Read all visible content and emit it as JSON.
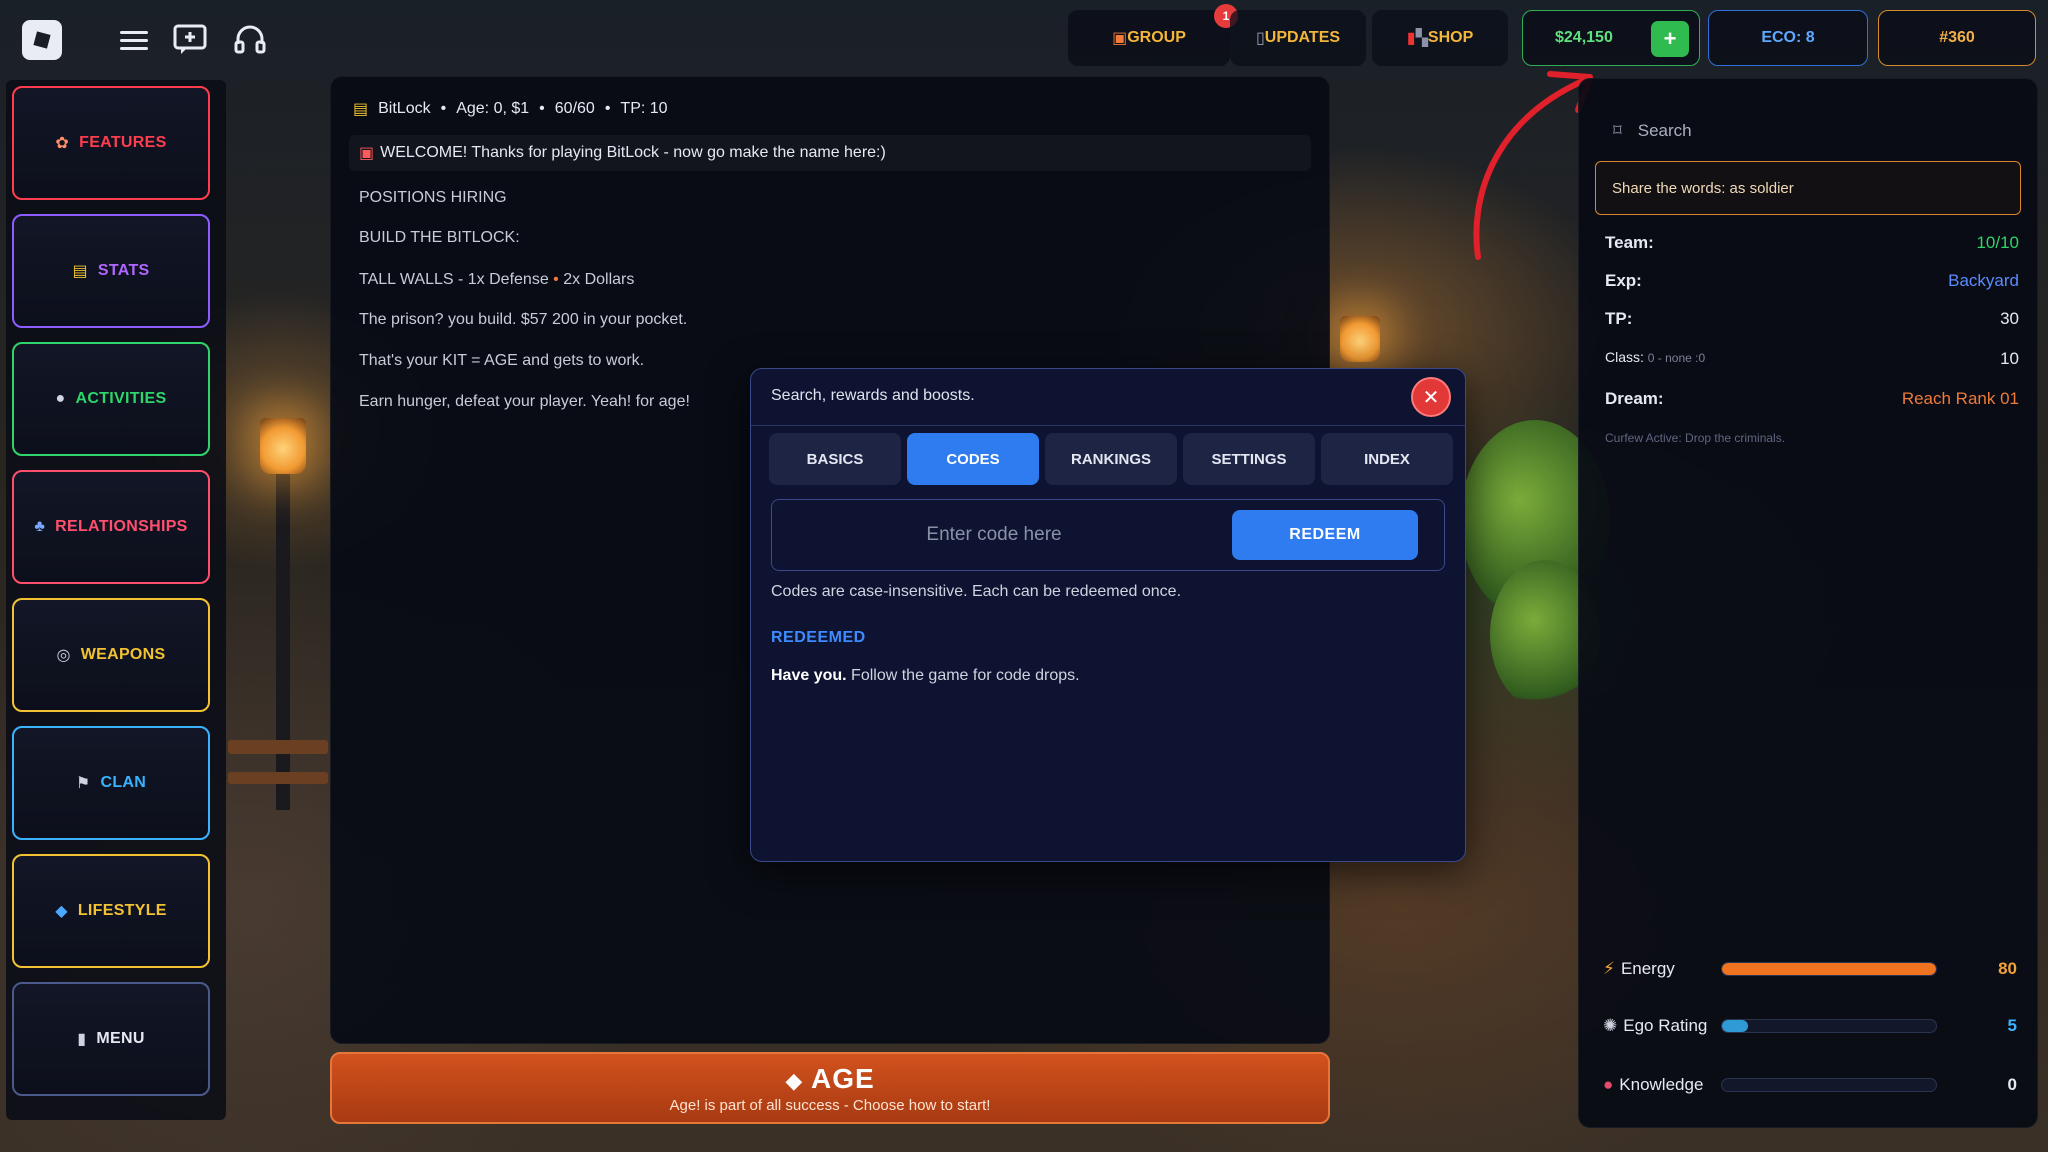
{
  "topbar": {
    "group_label": "GROUP",
    "group_badge": "1",
    "updates_label": "UPDATES",
    "shop_label": "SHOP",
    "money": "$24,150",
    "add_symbol": "+",
    "eco": "ECO: 8",
    "rank": "#360",
    "icons": [
      "roblox-logo",
      "hamburger-menu-icon",
      "chat-icon",
      "headset-icon",
      "gift-icon",
      "phone-icon",
      "ticket-icon"
    ]
  },
  "sidebar": {
    "items": [
      {
        "label": "FEATURES",
        "icon": "✿",
        "color": "#ff3d4e"
      },
      {
        "label": "STATS",
        "icon": "▤",
        "color": "#b067ff"
      },
      {
        "label": "ACTIVITIES",
        "icon": "●",
        "color": "#2fd46a"
      },
      {
        "label": "RELATIONSHIPS",
        "icon": "♣",
        "color": "#ff4f6d"
      },
      {
        "label": "WEAPONS",
        "icon": "◎",
        "color": "#f2c233"
      },
      {
        "label": "CLAN",
        "icon": "⚑",
        "color": "#3ab3ff"
      },
      {
        "label": "LIFESTYLE",
        "icon": "◆",
        "color": "#f2c233"
      },
      {
        "label": "MENU",
        "icon": "▮",
        "color": "#e6e9f2"
      }
    ]
  },
  "main": {
    "header": {
      "name": "BitLock",
      "age": "Age: 0, $1",
      "health": "60/60",
      "tp": "TP: 10"
    },
    "welcome": "WELCOME! Thanks for playing BitLock - now go make the name here:)",
    "lines": [
      "POSITIONS HIRING",
      "BUILD THE BITLOCK:",
      "TALL WALLS - 1x Defense",
      "2x Dollars",
      "The prison? you build. $57 200 in your pocket.",
      "That's your KIT = AGE and gets to work.",
      "Earn hunger, defeat your player. Yeah! for age!"
    ]
  },
  "age_button": {
    "title": "AGE",
    "subtitle": "Age! is part of all success - Choose how to start!"
  },
  "right_panel": {
    "search_label": "Search",
    "share_text": "Share the words: as soldier",
    "team_label": "Team:",
    "team_value": "10/10",
    "exp_label": "Exp:",
    "exp_value": "Backyard",
    "tp_label": "TP:",
    "tp_value": "30",
    "class_label": "Class:",
    "class_detail": "0 - none :0",
    "class_value": "10",
    "dream_label": "Dream:",
    "dream_value": "Reach Rank 01",
    "curfew_note": "Curfew Active: Drop the criminals.",
    "meters": [
      {
        "label": "Energy",
        "value": "80",
        "fill": 1.0,
        "color": "#f0741f",
        "value_color": "#f2a23a"
      },
      {
        "label": "Ego Rating",
        "value": "5",
        "fill": 0.12,
        "color": "#2f9bd6",
        "value_color": "#3db3ff"
      },
      {
        "label": "Knowledge",
        "value": "0",
        "fill": 0.0,
        "color": "#e54b6d",
        "value_color": "#e6e9f2"
      }
    ]
  },
  "modal": {
    "title": "Search, rewards and boosts.",
    "close_symbol": "✕",
    "tabs": [
      "BASICS",
      "CODES",
      "RANKINGS",
      "SETTINGS",
      "INDEX"
    ],
    "active_tab": "CODES",
    "code_placeholder": "Enter code here",
    "code_value": "",
    "redeem_label": "REDEEM",
    "note": "Codes are case-insensitive. Each can be redeemed once.",
    "redeemed_heading": "REDEEMED",
    "redeemed_bold": "Have you.",
    "redeemed_text": "Follow the game for code drops."
  }
}
